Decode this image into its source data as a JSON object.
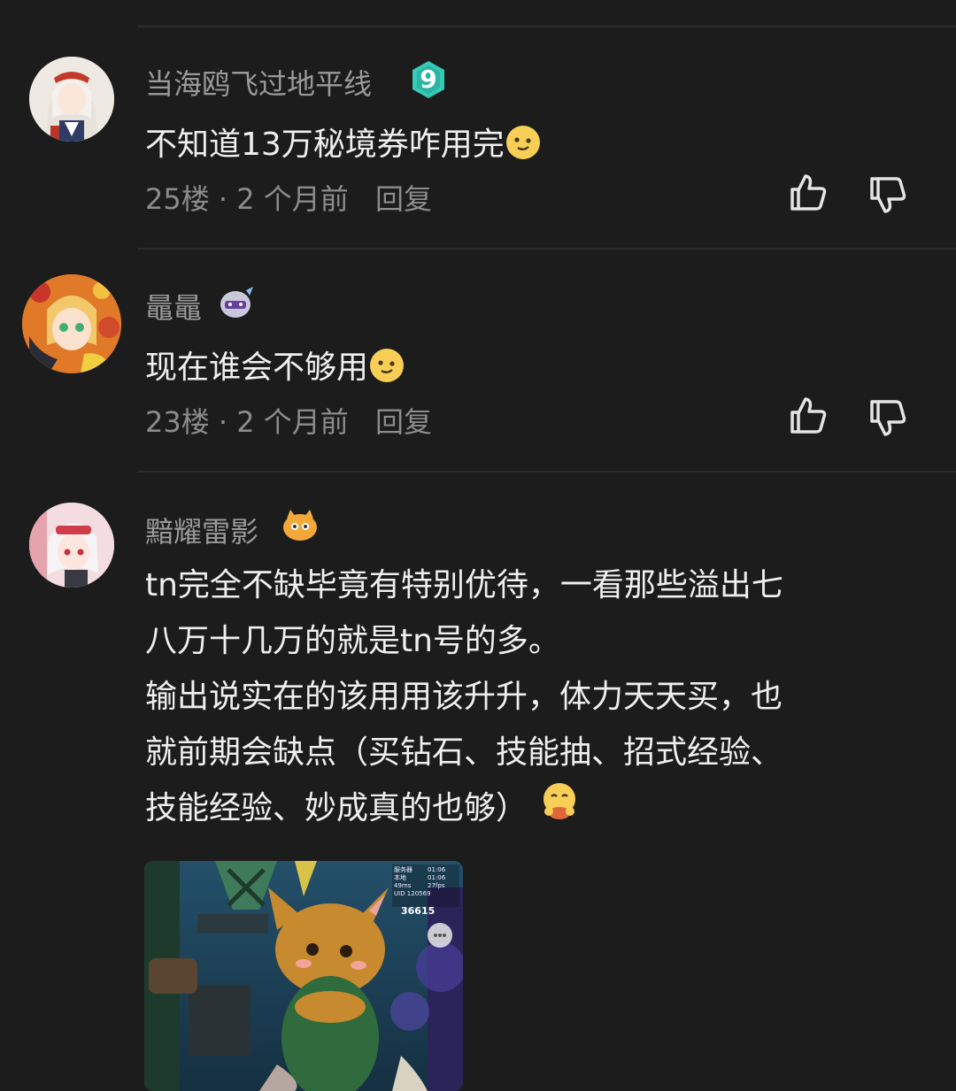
{
  "comments": [
    {
      "username": "当海鸥飞过地平线",
      "level": "9",
      "text": "不知道13万秘境券咋用完",
      "floor": "25楼",
      "time": "2 个月前",
      "reply": "回复"
    },
    {
      "username": "鼂鼂",
      "text": "现在谁会不够用",
      "floor": "23楼",
      "time": "2 个月前",
      "reply": "回复"
    },
    {
      "username": "黯耀雷影",
      "lines": [
        "tn完全不缺毕竟有特别优待，一看那些溢出七",
        "八万十几万的就是tn号的多。",
        "输出说实在的该用用该升升，体力天天买，也",
        "就前期会缺点（买钻石、技能抽、招式经验、",
        "技能经验、妙成真的也够）"
      ],
      "image_overlay": {
        "status_lines": [
          "服务器",
          "本地",
          "49ms",
          "UID 120569"
        ],
        "status_times": [
          "01:06",
          "01:06",
          "27fps"
        ],
        "score": "36615"
      }
    }
  ],
  "colors": {
    "background": "#1c1c1c",
    "level_badge": "#35c9b6",
    "username": "#9a9a9a",
    "text": "#efefef"
  }
}
